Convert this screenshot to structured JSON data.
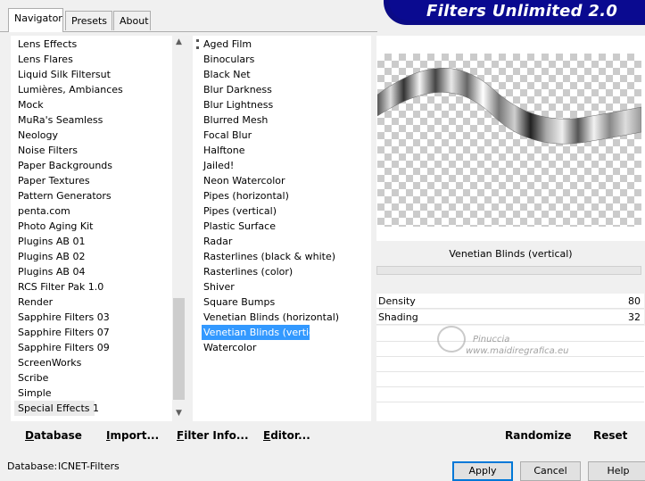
{
  "banner": {
    "title": "Filters Unlimited 2.0"
  },
  "tabs": [
    {
      "label": "Navigator",
      "active": true
    },
    {
      "label": "Presets",
      "active": false
    },
    {
      "label": "About",
      "active": false
    }
  ],
  "categories": {
    "items": [
      "Lens Effects",
      "Lens Flares",
      "Liquid Silk Filtersut",
      "Lumières, Ambiances",
      "Mock",
      "MuRa's Seamless",
      "Neology",
      "Noise Filters",
      "Paper Backgrounds",
      "Paper Textures",
      "Pattern Generators",
      "penta.com",
      "Photo Aging Kit",
      "Plugins AB 01",
      "Plugins AB 02",
      "Plugins AB 04",
      "RCS Filter Pak 1.0",
      "Render",
      "Sapphire Filters 03",
      "Sapphire Filters 07",
      "Sapphire Filters 09",
      "ScreenWorks",
      "Scribe",
      "Simple",
      "Special Effects 1"
    ],
    "selected_index": 24
  },
  "filters": {
    "items": [
      "Aged Film",
      "Binoculars",
      "Black Net",
      "Blur Darkness",
      "Blur Lightness",
      "Blurred Mesh",
      "Focal Blur",
      "Halftone",
      "Jailed!",
      "Neon Watercolor",
      "Pipes (horizontal)",
      "Pipes (vertical)",
      "Plastic Surface",
      "Radar",
      "Rasterlines (black & white)",
      "Rasterlines (color)",
      "Shiver",
      "Square Bumps",
      "Venetian Blinds (horizontal)",
      "Venetian Blinds (vertical)",
      "Watercolor"
    ],
    "selected_index": 19
  },
  "preview": {
    "filter_name": "Venetian Blinds (vertical)"
  },
  "params": [
    {
      "label": "Density",
      "value": "80"
    },
    {
      "label": "Shading",
      "value": "32"
    }
  ],
  "watermark": {
    "line1": "Pinuccia",
    "line2": "www.maidiregrafica.eu"
  },
  "buttons": {
    "database": "Database",
    "import": "Import...",
    "filter_info": "Filter Info...",
    "editor": "Editor...",
    "randomize": "Randomize",
    "reset": "Reset",
    "apply": "Apply",
    "cancel": "Cancel",
    "help": "Help"
  },
  "status": {
    "database_label": "Database:",
    "database_value": "ICNET-Filters"
  }
}
